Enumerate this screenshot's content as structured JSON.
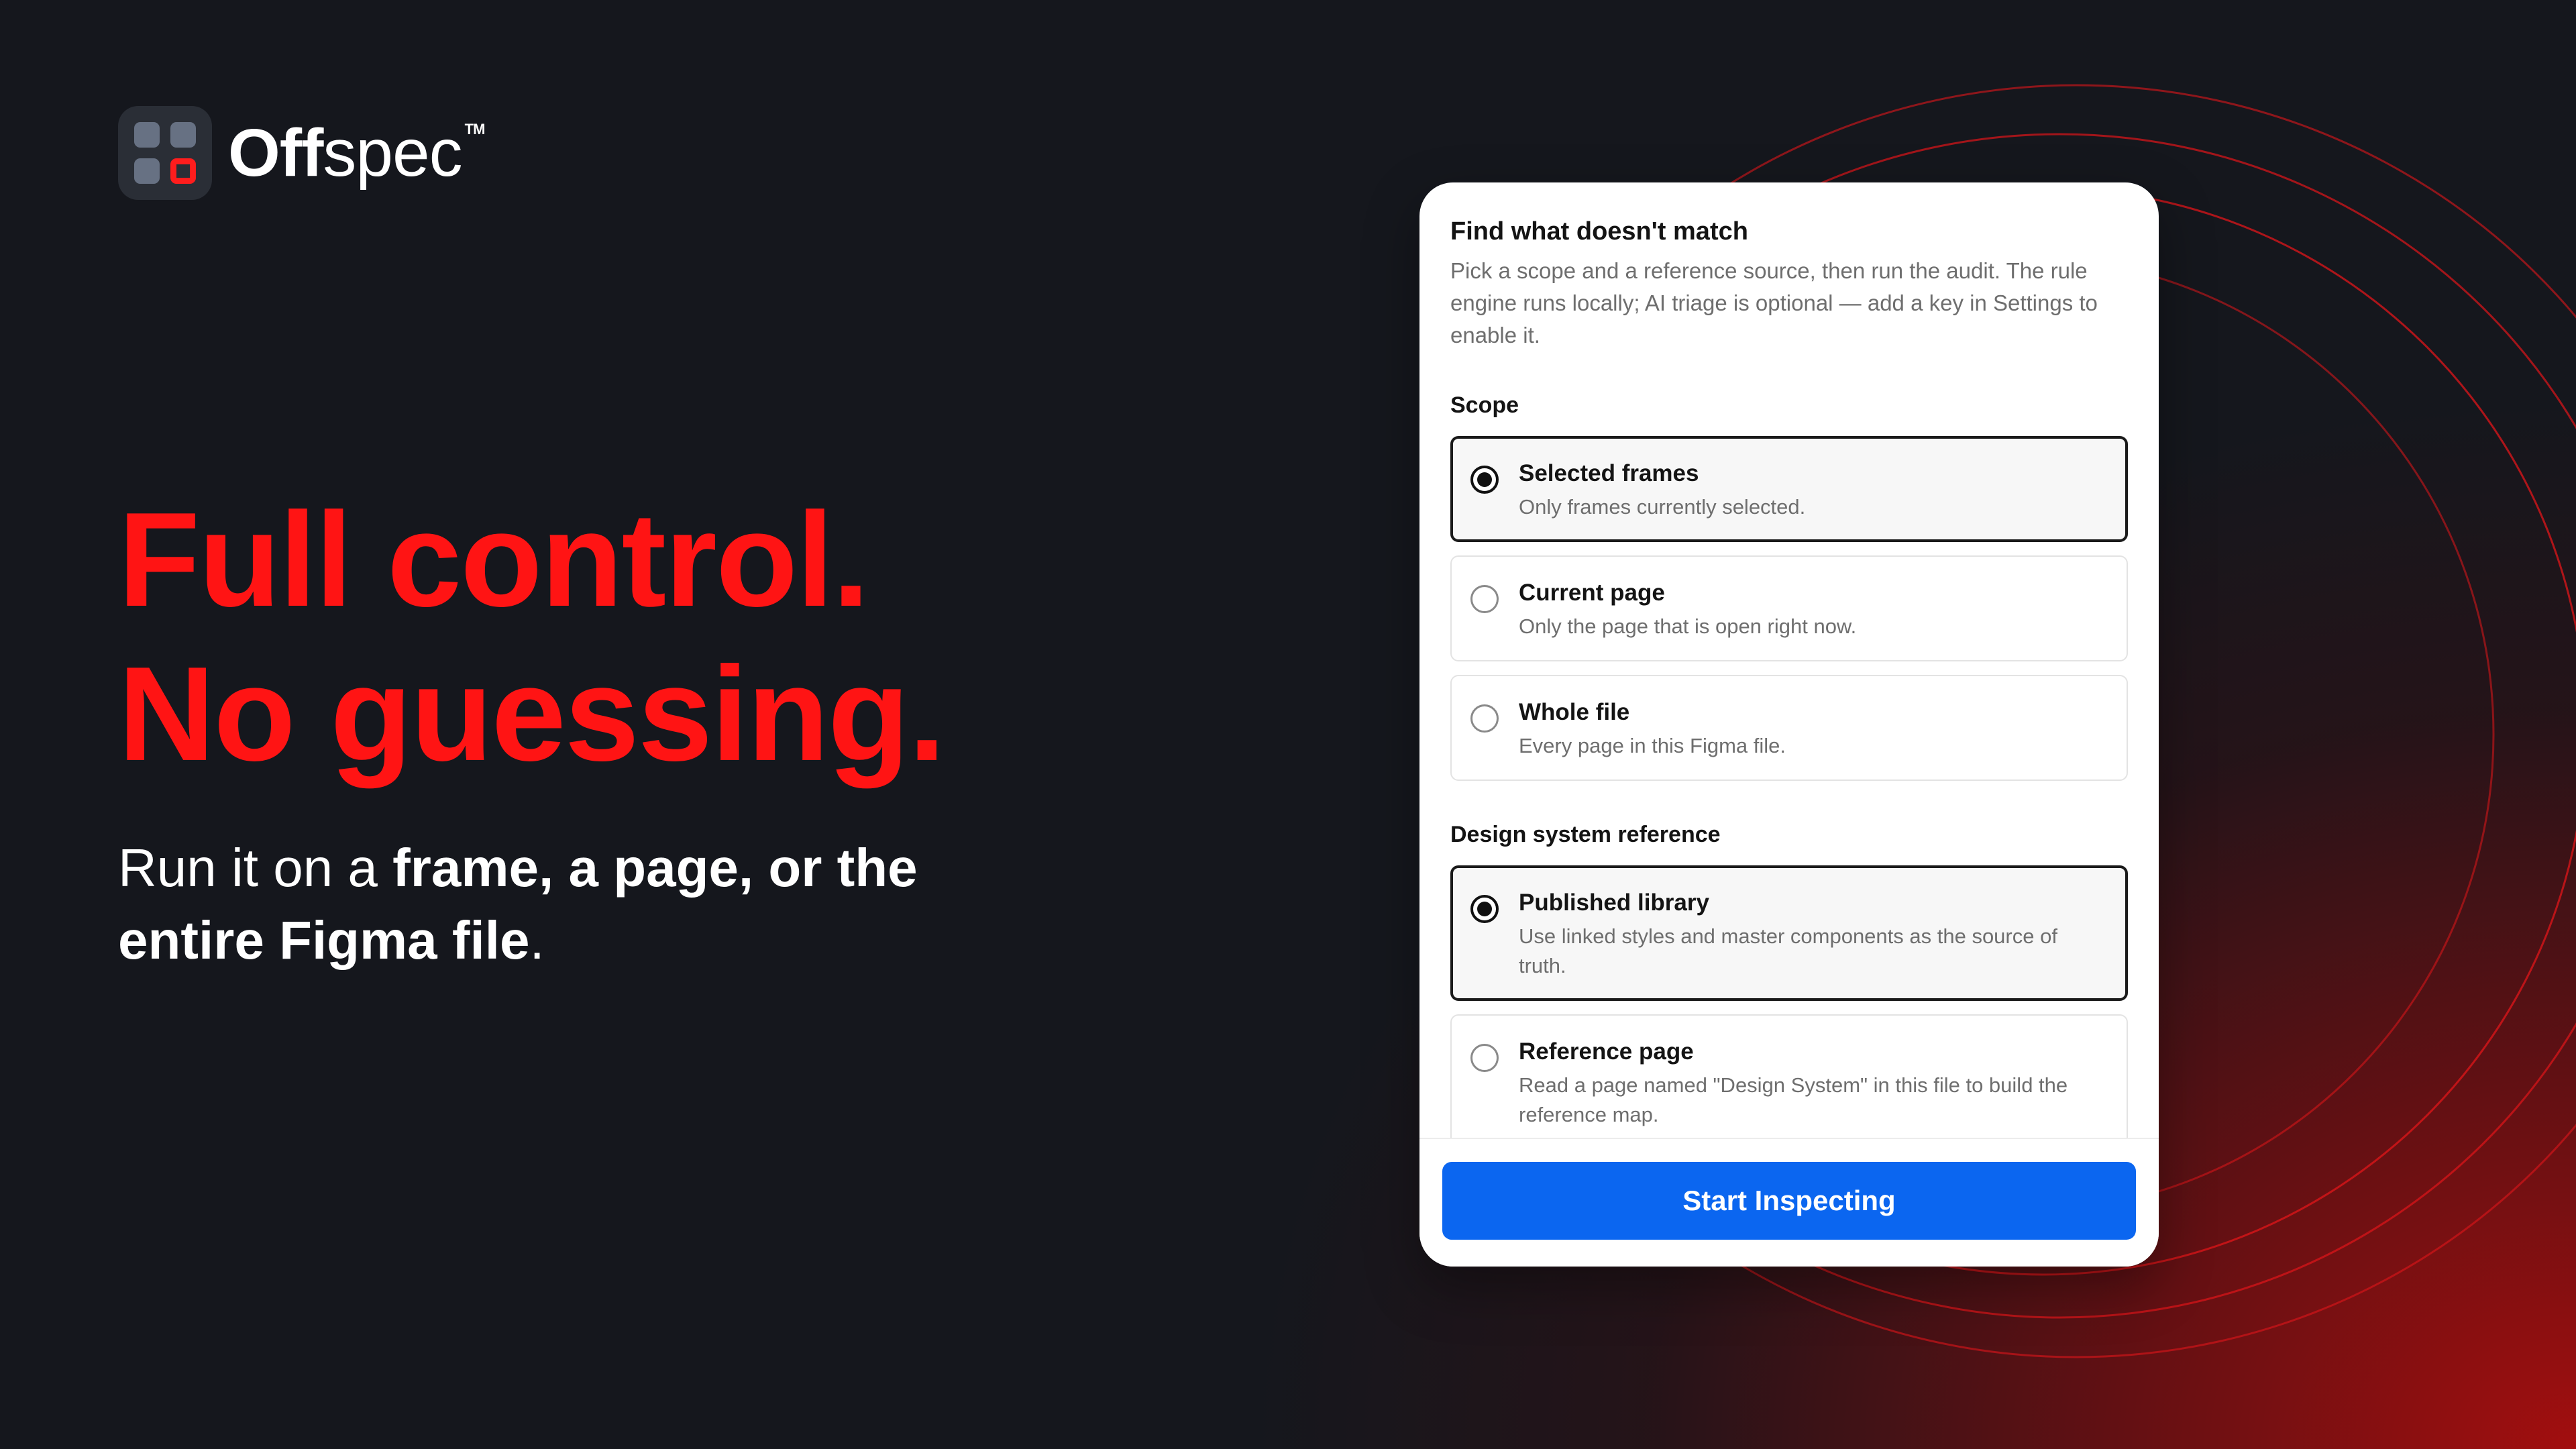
{
  "brand": {
    "name_bold": "Off",
    "name_light": "spec",
    "trademark": "TM"
  },
  "hero": {
    "headline_line1": "Full control.",
    "headline_line2": "No guessing.",
    "sub_prefix": "Run it on a ",
    "sub_bold": "frame, a page, or the entire Figma file",
    "sub_suffix": "."
  },
  "panel": {
    "title": "Find what doesn't match",
    "description": "Pick a scope and a reference source, then run the audit. The rule engine runs locally; AI triage is optional — add a key in Settings to enable it.",
    "scope": {
      "label": "Scope",
      "options": [
        {
          "title": "Selected frames",
          "description": "Only frames currently selected.",
          "selected": true
        },
        {
          "title": "Current page",
          "description": "Only the page that is open right now.",
          "selected": false
        },
        {
          "title": "Whole file",
          "description": "Every page in this Figma file.",
          "selected": false
        }
      ]
    },
    "reference": {
      "label": "Design system reference",
      "options": [
        {
          "title": "Published library",
          "description": "Use linked styles and master components as the source of truth.",
          "selected": true
        },
        {
          "title": "Reference page",
          "description": "Read a page named \"Design System\" in this file to build the reference map.",
          "selected": false
        }
      ]
    },
    "start_label": "Start Inspecting"
  },
  "colors": {
    "background": "#15171d",
    "accent_red": "#ff1414",
    "button_blue": "#0b66f0"
  },
  "icons": {
    "logo": "offspec-grid-logo",
    "radio_selected": "radio-checked-icon",
    "radio_unselected": "radio-unchecked-icon"
  }
}
